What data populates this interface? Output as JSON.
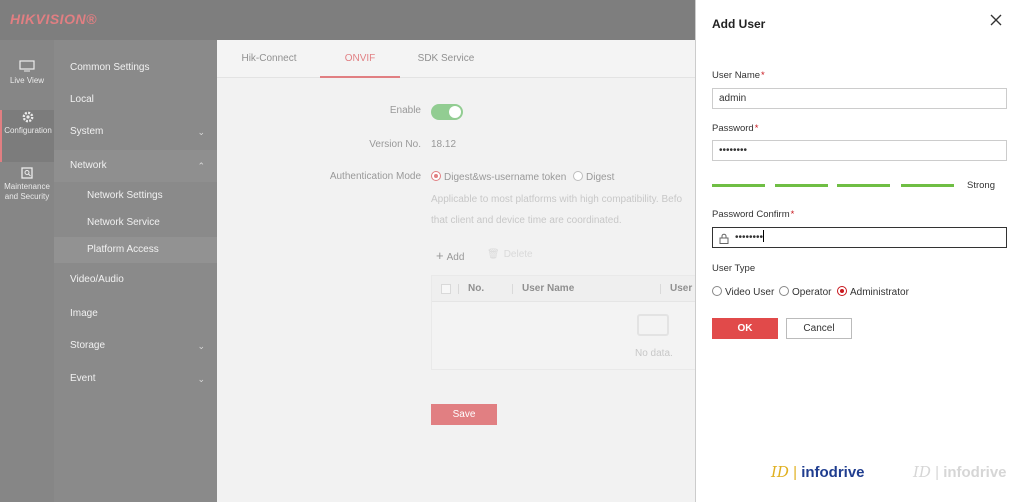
{
  "app": {
    "logo": "HIKVISION®"
  },
  "leftnav": [
    {
      "label": "Live View",
      "icon": "monitor-icon"
    },
    {
      "label": "Configuration",
      "icon": "gear-icon"
    },
    {
      "label": "Maintenance and Security",
      "icon": "shield-icon"
    }
  ],
  "sidemenu": {
    "common_settings": "Common Settings",
    "local": "Local",
    "system": "System",
    "network": "Network",
    "network_settings": "Network Settings",
    "network_service": "Network Service",
    "platform_access": "Platform Access",
    "video_audio": "Video/Audio",
    "image": "Image",
    "storage": "Storage",
    "event": "Event"
  },
  "tabs": [
    "Hik-Connect",
    "ONVIF",
    "SDK Service"
  ],
  "form": {
    "enable_label": "Enable",
    "enable_on": true,
    "version_label": "Version No.",
    "version_value": "18.12",
    "auth_label": "Authentication Mode",
    "auth_opt1": "Digest&ws-username token",
    "auth_opt2": "Digest",
    "hint1": "Applicable to most platforms with high compatibility. Befo",
    "hint2": "that client and device time are coordinated.",
    "add": "Add",
    "delete": "Delete",
    "col_no": "No.",
    "col_user": "User Name",
    "col_type": "User T",
    "nodata": "No data.",
    "save": "Save"
  },
  "dialog": {
    "title": "Add User",
    "username_label": "User Name",
    "username_value": "admin",
    "password_label": "Password",
    "password_value": "••••••••",
    "strength": "Strong",
    "confirm_label": "Password Confirm",
    "confirm_value": "••••••••",
    "usertype_label": "User Type",
    "type_video": "Video User",
    "type_operator": "Operator",
    "type_admin": "Administrator",
    "ok": "OK",
    "cancel": "Cancel"
  },
  "watermark": {
    "mark": "ID",
    "brand": "infodrive"
  },
  "colors": {
    "accent": "#c8161d",
    "toggle": "#3aa53a",
    "strength": "#6fbe44",
    "watermark": "#1f3d8f"
  }
}
